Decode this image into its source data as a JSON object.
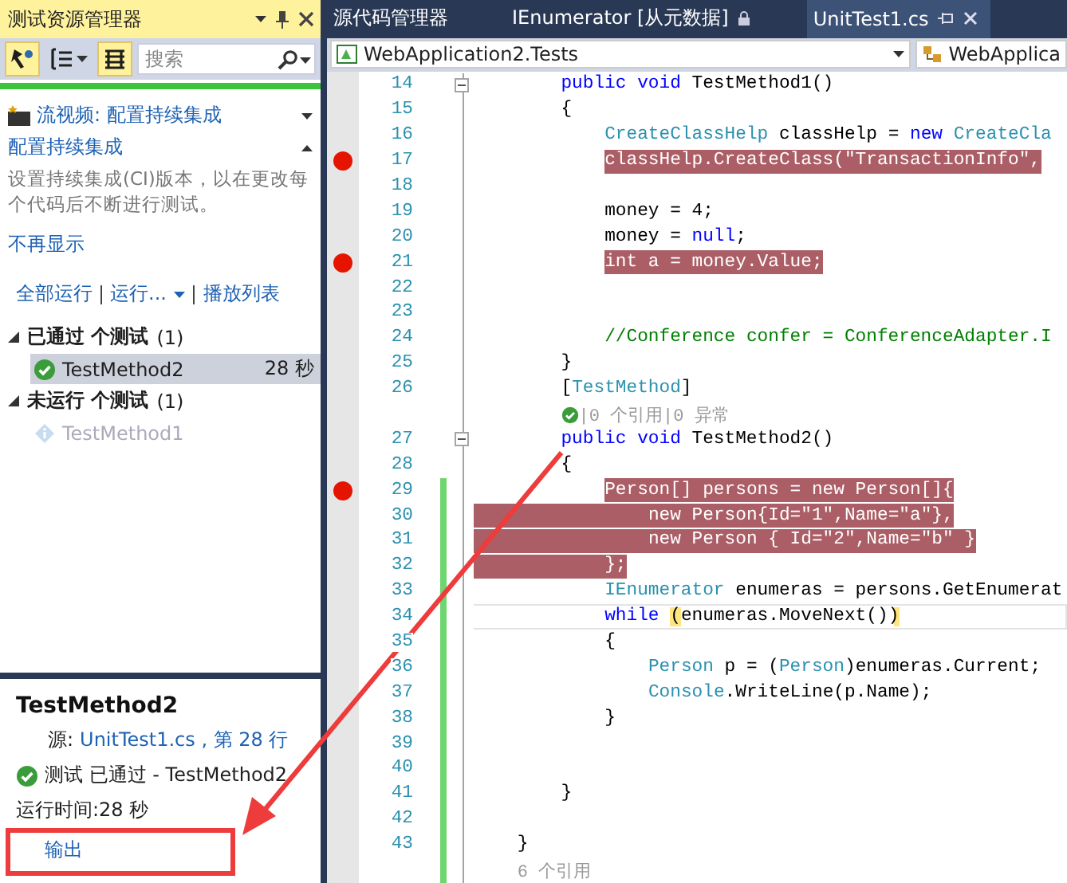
{
  "test_explorer": {
    "title": "测试资源管理器",
    "all_passed": true,
    "toolbar": [
      {
        "kind": "run",
        "on": true
      },
      {
        "kind": "group",
        "on": false
      },
      {
        "kind": "list",
        "on": true
      }
    ],
    "search": {
      "placeholder": "搜索"
    },
    "notice": {
      "title": "流视频: 配置持续集成",
      "heading": "配置持续集成",
      "body": "设置持续集成(CI)版本，以在更改每个代码后不断进行测试。",
      "dismiss": "不再显示"
    },
    "actions": [
      {
        "label": "全部运行",
        "dropdown": false
      },
      {
        "label": "运行...",
        "dropdown": true
      },
      {
        "label": "播放列表",
        "dropdown": false
      }
    ],
    "groups": [
      {
        "label": "已通过 个测试",
        "count": "(1)",
        "expanded": true,
        "tests": [
          {
            "name": "TestMethod2",
            "passed": true,
            "duration": "28 秒",
            "selected": true
          }
        ]
      },
      {
        "label": "未运行 个测试",
        "count": "(1)",
        "expanded": true,
        "tests": [
          {
            "name": "TestMethod1",
            "passed": false,
            "selected": false
          }
        ]
      }
    ],
    "detail": {
      "title": "TestMethod2",
      "source_label": "源:",
      "source_link": "UnitTest1.cs , 第 28 行",
      "passed": true,
      "result": "测试 已通过 - TestMethod2",
      "elapsed": "运行时间:28 秒",
      "output_link": "输出"
    }
  },
  "editor": {
    "tabs": [
      {
        "label": "源代码管理器",
        "selected": false,
        "locked": false
      },
      {
        "label": "IEnumerator [从元数据]",
        "selected": false,
        "locked": true
      },
      {
        "label": "UnitTest1.cs",
        "selected": true,
        "locked": false
      }
    ],
    "project": "WebApplication2.Tests",
    "member": "WebApplica",
    "lines": [
      {
        "kind": "code",
        "number": "14",
        "breakpoint": false,
        "changed": false,
        "collapsible": true,
        "current": false,
        "highlighted": false,
        "segments": [
          {
            "kind": "keyword",
            "text": "        public void"
          },
          {
            "kind": "plain",
            "text": " TestMethod1()"
          }
        ]
      },
      {
        "kind": "code",
        "number": "15",
        "breakpoint": false,
        "changed": false,
        "collapsible": false,
        "current": false,
        "highlighted": false,
        "segments": [
          {
            "kind": "plain",
            "text": "        {"
          }
        ]
      },
      {
        "kind": "code",
        "number": "16",
        "breakpoint": false,
        "changed": false,
        "collapsible": false,
        "current": false,
        "highlighted": false,
        "segments": [
          {
            "kind": "type",
            "text": "            CreateClassHelp"
          },
          {
            "kind": "plain",
            "text": " classHelp = "
          },
          {
            "kind": "keyword",
            "text": "new"
          },
          {
            "kind": "type",
            "text": " CreateCla"
          }
        ]
      },
      {
        "kind": "code",
        "number": "17",
        "breakpoint": true,
        "changed": false,
        "collapsible": false,
        "current": false,
        "highlighted": true,
        "segments": [
          {
            "kind": "plain",
            "text": "            classHelp.CreateClass(\"TransactionInfo\","
          }
        ]
      },
      {
        "kind": "code",
        "number": "18",
        "breakpoint": false,
        "changed": false,
        "collapsible": false,
        "current": false,
        "highlighted": false
      },
      {
        "kind": "code",
        "number": "19",
        "breakpoint": false,
        "changed": false,
        "collapsible": false,
        "current": false,
        "highlighted": false,
        "segments": [
          {
            "kind": "plain",
            "text": "            money = 4;"
          }
        ]
      },
      {
        "kind": "code",
        "number": "20",
        "breakpoint": false,
        "changed": false,
        "collapsible": false,
        "current": false,
        "highlighted": false,
        "segments": [
          {
            "kind": "plain",
            "text": "            money = "
          },
          {
            "kind": "keyword",
            "text": "null"
          },
          {
            "kind": "plain",
            "text": ";"
          }
        ]
      },
      {
        "kind": "code",
        "number": "21",
        "breakpoint": true,
        "changed": false,
        "collapsible": false,
        "current": false,
        "highlighted": true,
        "segments": [
          {
            "kind": "plain",
            "text": "            int a = money.Value;"
          }
        ]
      },
      {
        "kind": "code",
        "number": "22",
        "breakpoint": false,
        "changed": false,
        "collapsible": false,
        "current": false,
        "highlighted": false
      },
      {
        "kind": "code",
        "number": "23",
        "breakpoint": false,
        "changed": false,
        "collapsible": false,
        "current": false,
        "highlighted": false
      },
      {
        "kind": "code",
        "number": "24",
        "breakpoint": false,
        "changed": false,
        "collapsible": false,
        "current": false,
        "highlighted": false,
        "segments": [
          {
            "kind": "comment",
            "text": "            //Conference confer = ConferenceAdapter.I"
          }
        ]
      },
      {
        "kind": "code",
        "number": "25",
        "breakpoint": false,
        "changed": false,
        "collapsible": false,
        "current": false,
        "highlighted": false,
        "segments": [
          {
            "kind": "plain",
            "text": "        }"
          }
        ]
      },
      {
        "kind": "code",
        "number": "26",
        "breakpoint": false,
        "changed": false,
        "collapsible": false,
        "current": false,
        "highlighted": false,
        "segments": [
          {
            "kind": "plain",
            "text": "        ["
          },
          {
            "kind": "type",
            "text": "TestMethod"
          },
          {
            "kind": "plain",
            "text": "]"
          }
        ]
      },
      {
        "kind": "codelens",
        "changed": false,
        "passed": true,
        "text": "        |0 个引用|0 异常"
      },
      {
        "kind": "code",
        "number": "27",
        "breakpoint": false,
        "changed": false,
        "collapsible": true,
        "current": false,
        "highlighted": false,
        "segments": [
          {
            "kind": "keyword",
            "text": "        public void"
          },
          {
            "kind": "plain",
            "text": " TestMethod2()"
          }
        ]
      },
      {
        "kind": "code",
        "number": "28",
        "breakpoint": false,
        "changed": false,
        "collapsible": false,
        "current": false,
        "highlighted": false,
        "segments": [
          {
            "kind": "plain",
            "text": "        {"
          }
        ]
      },
      {
        "kind": "code",
        "number": "29",
        "breakpoint": true,
        "changed": true,
        "collapsible": false,
        "current": false,
        "highlighted": true,
        "segments": [
          {
            "kind": "plain",
            "text": "            Person[] persons = new Person[]{"
          }
        ]
      },
      {
        "kind": "code",
        "number": "30",
        "breakpoint": false,
        "changed": true,
        "collapsible": false,
        "current": false,
        "highlighted": true,
        "segments": [
          {
            "kind": "plain",
            "text": "                new Person{Id=\"1\",Name=\"a\"},"
          }
        ]
      },
      {
        "kind": "code",
        "number": "31",
        "breakpoint": false,
        "changed": true,
        "collapsible": false,
        "current": false,
        "highlighted": true,
        "segments": [
          {
            "kind": "plain",
            "text": "                new Person { Id=\"2\",Name=\"b\" }"
          }
        ]
      },
      {
        "kind": "code",
        "number": "32",
        "breakpoint": false,
        "changed": true,
        "collapsible": false,
        "current": false,
        "highlighted": true,
        "segments": [
          {
            "kind": "plain",
            "text": "            };"
          }
        ]
      },
      {
        "kind": "code",
        "number": "33",
        "breakpoint": false,
        "changed": true,
        "collapsible": false,
        "current": false,
        "highlighted": false,
        "segments": [
          {
            "kind": "type",
            "text": "            IEnumerator"
          },
          {
            "kind": "plain",
            "text": " enumeras = persons.GetEnumerat"
          }
        ]
      },
      {
        "kind": "code",
        "number": "34",
        "breakpoint": false,
        "changed": true,
        "collapsible": false,
        "current": true,
        "highlighted": false,
        "segments": [
          {
            "kind": "keyword",
            "text": "            while"
          },
          {
            "kind": "brace",
            "text": " ("
          },
          {
            "kind": "plain",
            "text": "enumeras.MoveNext()"
          },
          {
            "kind": "brace",
            "text": ")"
          }
        ]
      },
      {
        "kind": "code",
        "number": "35",
        "breakpoint": false,
        "changed": true,
        "collapsible": false,
        "current": false,
        "highlighted": false,
        "segments": [
          {
            "kind": "plain",
            "text": "            {"
          }
        ]
      },
      {
        "kind": "code",
        "number": "36",
        "breakpoint": false,
        "changed": true,
        "collapsible": false,
        "current": false,
        "highlighted": false,
        "segments": [
          {
            "kind": "type",
            "text": "                Person"
          },
          {
            "kind": "plain",
            "text": " p = ("
          },
          {
            "kind": "type",
            "text": "Person"
          },
          {
            "kind": "plain",
            "text": ")enumeras.Current;"
          }
        ]
      },
      {
        "kind": "code",
        "number": "37",
        "breakpoint": false,
        "changed": true,
        "collapsible": false,
        "current": false,
        "highlighted": false,
        "segments": [
          {
            "kind": "type",
            "text": "                Console"
          },
          {
            "kind": "plain",
            "text": ".WriteLine(p.Name);"
          }
        ]
      },
      {
        "kind": "code",
        "number": "38",
        "breakpoint": false,
        "changed": true,
        "collapsible": false,
        "current": false,
        "highlighted": false,
        "segments": [
          {
            "kind": "plain",
            "text": "            }"
          }
        ]
      },
      {
        "kind": "code",
        "number": "39",
        "breakpoint": false,
        "changed": true,
        "collapsible": false,
        "current": false,
        "highlighted": false
      },
      {
        "kind": "code",
        "number": "40",
        "breakpoint": false,
        "changed": true,
        "collapsible": false,
        "current": false,
        "highlighted": false
      },
      {
        "kind": "code",
        "number": "41",
        "breakpoint": false,
        "changed": true,
        "collapsible": false,
        "current": false,
        "highlighted": false,
        "segments": [
          {
            "kind": "plain",
            "text": "        }"
          }
        ]
      },
      {
        "kind": "code",
        "number": "42",
        "breakpoint": false,
        "changed": true,
        "collapsible": false,
        "current": false,
        "highlighted": false
      },
      {
        "kind": "code",
        "number": "43",
        "breakpoint": false,
        "changed": true,
        "collapsible": false,
        "current": false,
        "highlighted": false,
        "segments": [
          {
            "kind": "plain",
            "text": "    }"
          }
        ]
      },
      {
        "kind": "codelens",
        "changed": true,
        "passed": false,
        "text": "    6 个引用"
      }
    ]
  }
}
